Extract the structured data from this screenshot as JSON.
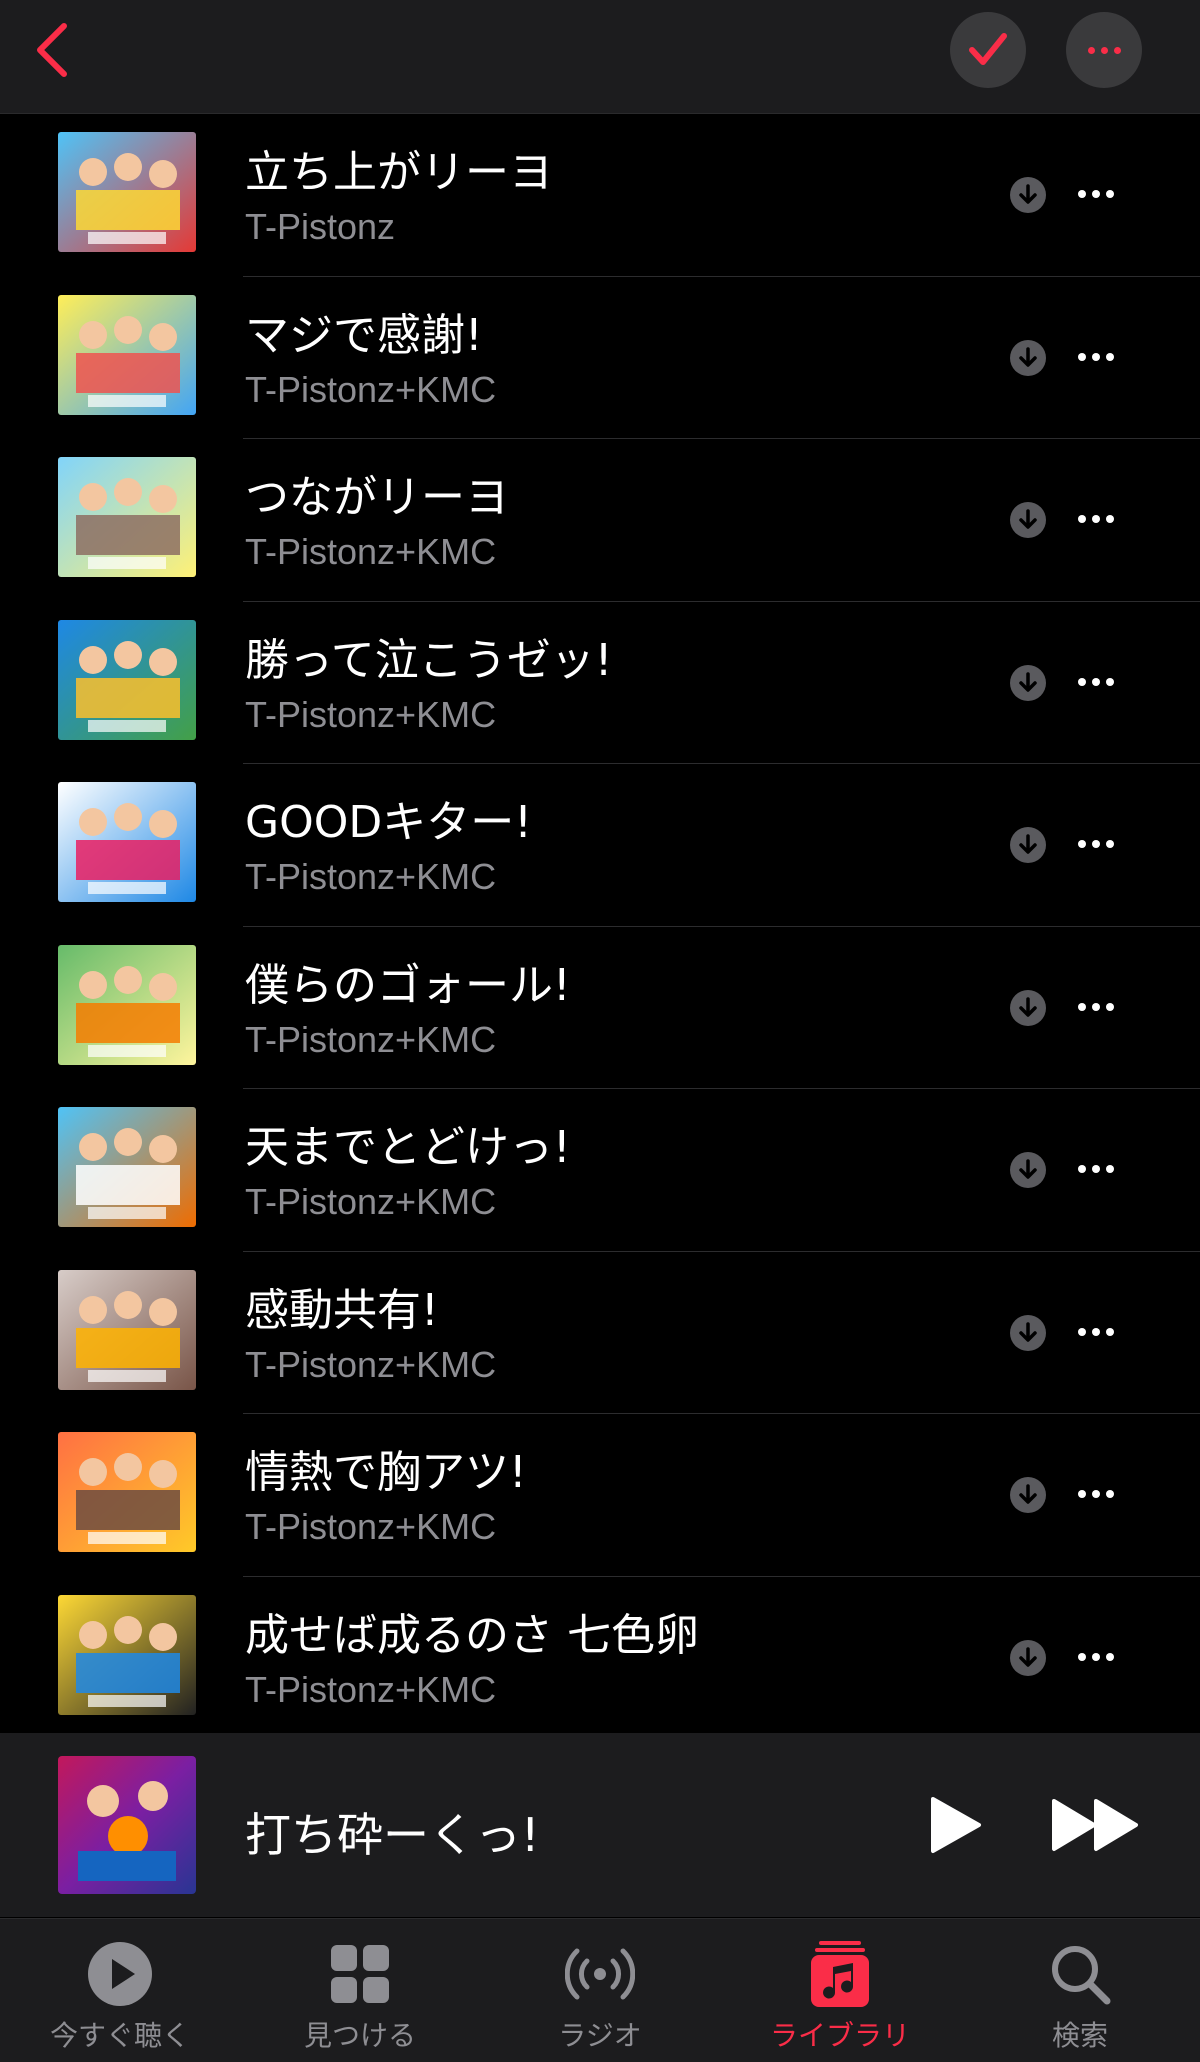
{
  "header": {
    "back_icon": "chevron-left-icon",
    "select_icon": "checkmark-icon",
    "more_icon": "ellipsis-icon",
    "accent_color": "#fa2d48"
  },
  "songs": [
    {
      "title": "立ち上がリーヨ",
      "artist": "T-Pistonz"
    },
    {
      "title": "マジで感謝!",
      "artist": "T-Pistonz+KMC"
    },
    {
      "title": "つながリーヨ",
      "artist": "T-Pistonz+KMC"
    },
    {
      "title": "勝って泣こうゼッ!",
      "artist": "T-Pistonz+KMC"
    },
    {
      "title": "GOODキター!",
      "artist": "T-Pistonz+KMC"
    },
    {
      "title": "僕らのゴォール!",
      "artist": "T-Pistonz+KMC"
    },
    {
      "title": "天までとどけっ!",
      "artist": "T-Pistonz+KMC"
    },
    {
      "title": "感動共有!",
      "artist": "T-Pistonz+KMC"
    },
    {
      "title": "情熱で胸アツ!",
      "artist": "T-Pistonz+KMC"
    },
    {
      "title": "成せば成るのさ 七色卵",
      "artist": "T-Pistonz+KMC"
    }
  ],
  "now_playing": {
    "title": "打ち砕ーくっ!",
    "play_icon": "play-icon",
    "forward_icon": "fast-forward-icon"
  },
  "tabs": [
    {
      "label": "今すぐ聴く",
      "icon": "play-circle-icon",
      "active": false
    },
    {
      "label": "見つける",
      "icon": "grid-icon",
      "active": false
    },
    {
      "label": "ラジオ",
      "icon": "radio-waves-icon",
      "active": false
    },
    {
      "label": "ライブラリ",
      "icon": "music-library-icon",
      "active": true
    },
    {
      "label": "検索",
      "icon": "search-icon",
      "active": false
    }
  ]
}
